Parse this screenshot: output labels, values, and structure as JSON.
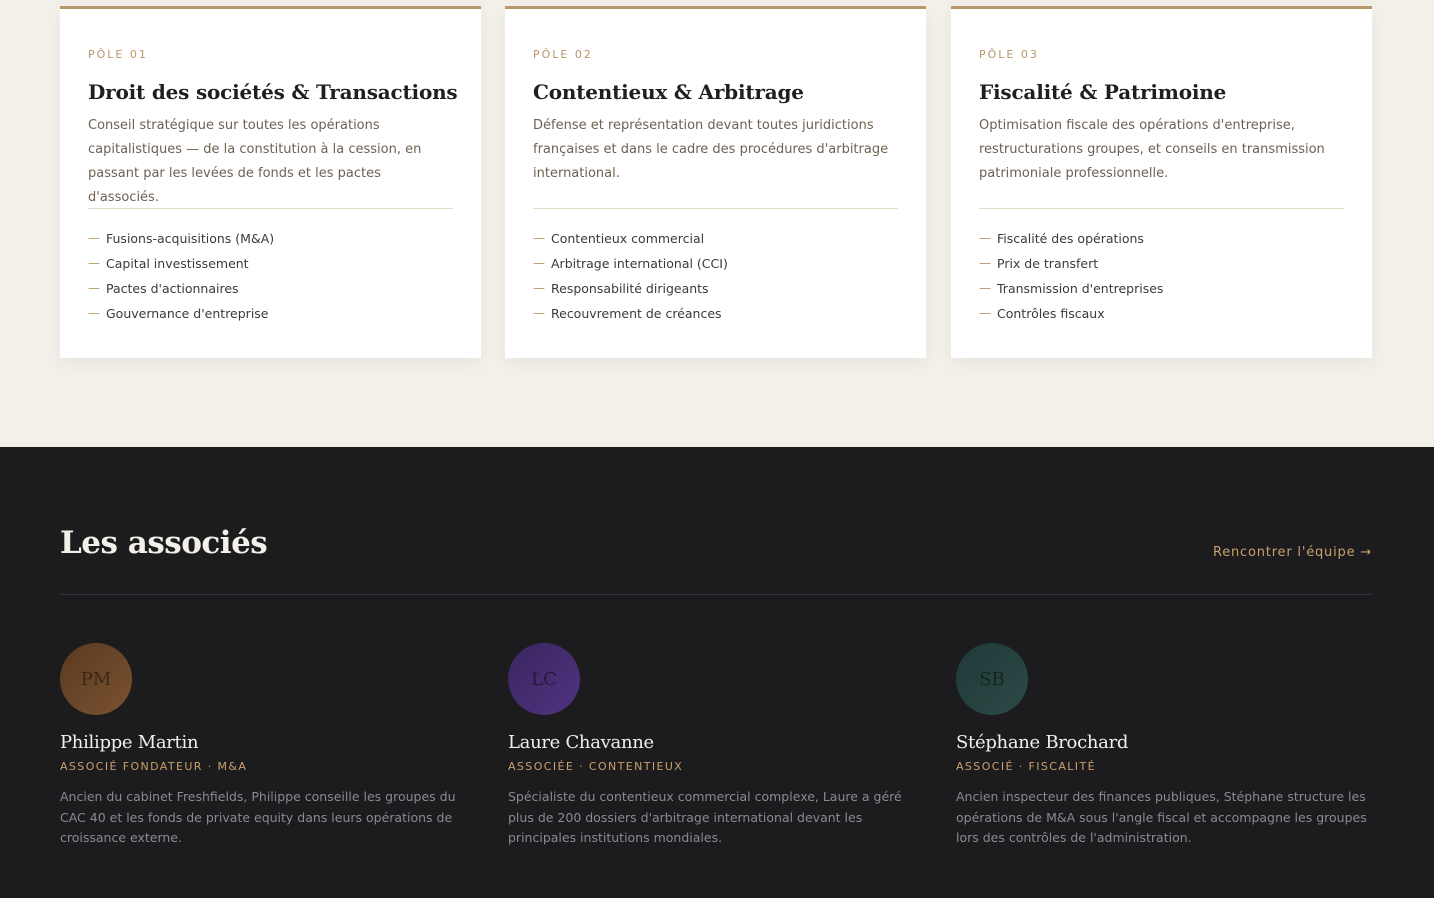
{
  "practice_areas": [
    {
      "eyebrow": "PÔLE 01",
      "title": "Droit des sociétés & Transactions",
      "description": "Conseil stratégique sur toutes les opérations capitalistiques — de la constitution à la cession, en passant par les levées de fonds et les pactes d'associés.",
      "items": [
        "Fusions-acquisitions (M&A)",
        "Capital investissement",
        "Pactes d'actionnaires",
        "Gouvernance d'entreprise"
      ]
    },
    {
      "eyebrow": "PÔLE 02",
      "title": "Contentieux & Arbitrage",
      "description": "Défense et représentation devant toutes juridictions françaises et dans le cadre des procédures d'arbitrage international.",
      "items": [
        "Contentieux commercial",
        "Arbitrage international (CCI)",
        "Responsabilité dirigeants",
        "Recouvrement de créances"
      ]
    },
    {
      "eyebrow": "PÔLE 03",
      "title": "Fiscalité & Patrimoine",
      "description": "Optimisation fiscale des opérations d'entreprise, restructurations groupes, et conseils en transmission patrimoniale professionnelle.",
      "items": [
        "Fiscalité des opérations",
        "Prix de transfert",
        "Transmission d'entreprises",
        "Contrôles fiscaux"
      ]
    }
  ],
  "list_dash": "—",
  "partners_section": {
    "title": "Les associés",
    "link_label": "Rencontrer l'équipe →"
  },
  "partners": [
    {
      "initials": "PM",
      "avatar_color_from": "#5a3a22",
      "avatar_color_to": "#7a5230",
      "name": "Philippe Martin",
      "role": "ASSOCIÉ FONDATEUR · M&A",
      "bio": "Ancien du cabinet Freshfields, Philippe conseille les groupes du CAC 40 et les fonds de private equity dans leurs opérations de croissance externe."
    },
    {
      "initials": "LC",
      "avatar_color_from": "#3a2560",
      "avatar_color_to": "#4f3480",
      "name": "Laure Chavanne",
      "role": "ASSOCIÉE · CONTENTIEUX",
      "bio": "Spécialiste du contentieux commercial complexe, Laure a géré plus de 200 dossiers d'arbitrage international devant les principales institutions mondiales."
    },
    {
      "initials": "SB",
      "avatar_color_from": "#1f3a38",
      "avatar_color_to": "#2c4a47",
      "name": "Stéphane Brochard",
      "role": "ASSOCIÉ · FISCALITÉ",
      "bio": "Ancien inspecteur des finances publiques, Stéphane structure les opérations de M&A sous l'angle fiscal et accompagne les groupes lors des contrôles de l'administration."
    }
  ],
  "colors": {
    "accent_gold": "#b8976a",
    "page_cream": "#f3f0ea",
    "dark_bg": "#1c1c1f"
  }
}
